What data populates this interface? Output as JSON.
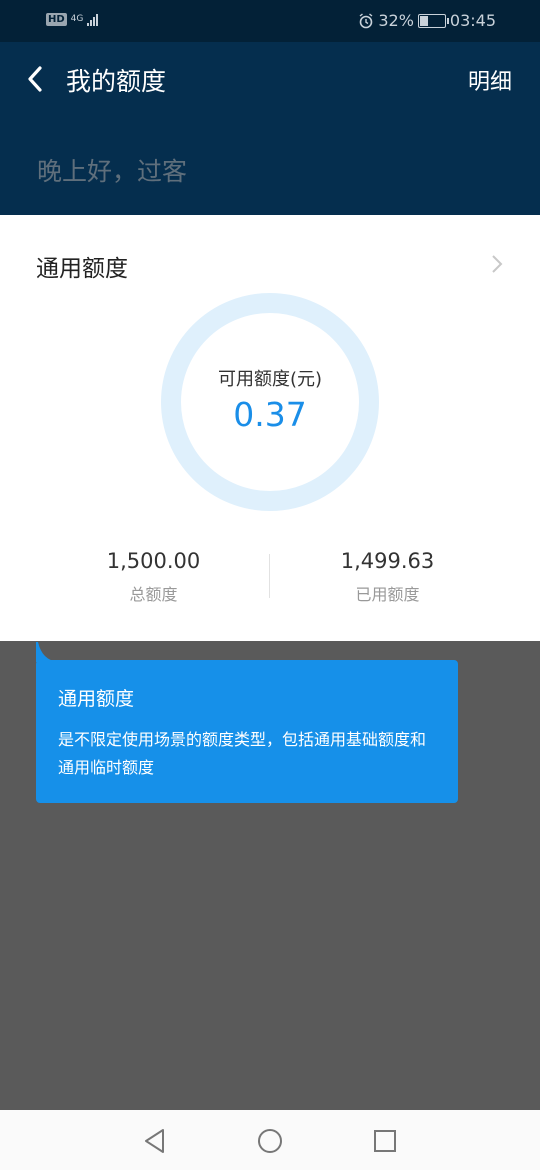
{
  "status_bar": {
    "hd": "HD",
    "network": "4G",
    "battery": "32%",
    "battery_level": 0.32,
    "time": "03:45"
  },
  "header": {
    "title": "我的额度",
    "detail_link": "明细",
    "greeting": "晚上好，过客"
  },
  "card": {
    "title": "通用额度",
    "available_label": "可用额度(元)",
    "available_value": "0.37",
    "total_value": "1,500.00",
    "total_label": "总额度",
    "used_value": "1,499.63",
    "used_label": "已用额度"
  },
  "tip": {
    "title": "通用额度",
    "body": "是不限定使用场景的额度类型，包括通用基础额度和通用临时额度"
  },
  "colors": {
    "header_bg": "#052e4e",
    "accent": "#1a8ee8",
    "tip_bg": "#1690e9",
    "overlay": "#5a5a5a"
  },
  "icons": [
    "back-arrow-icon",
    "chevron-right-icon",
    "alarm-icon",
    "nav-back-icon",
    "nav-home-icon",
    "nav-recent-icon"
  ]
}
